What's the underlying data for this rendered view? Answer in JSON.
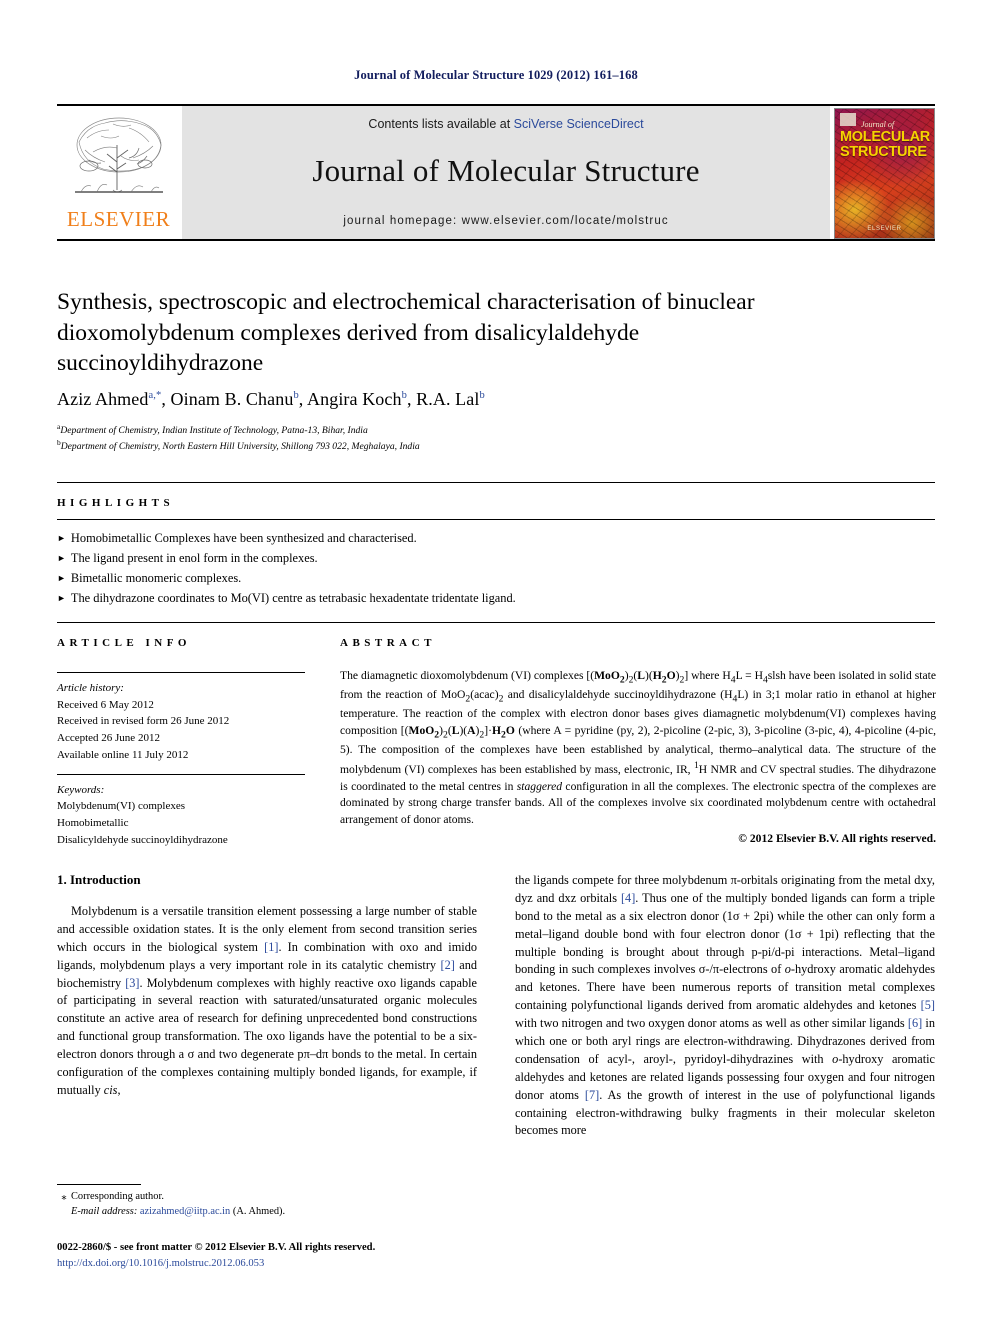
{
  "running_head": "Journal of Molecular Structure 1029 (2012) 161–168",
  "masthead": {
    "publisher_name": "ELSEVIER",
    "contents_prefix": "Contents lists available at ",
    "contents_link": "SciVerse ScienceDirect",
    "journal_title": "Journal of Molecular Structure",
    "homepage_line": "journal homepage: www.elsevier.com/locate/molstruc",
    "cover": {
      "journal_of": "Journal of",
      "title": "MOLECULAR STRUCTURE",
      "publisher": "ELSEVIER"
    }
  },
  "article": {
    "title": "Synthesis, spectroscopic and electrochemical characterisation of binuclear dioxomolybdenum complexes derived from disalicylaldehyde succinoyldihydrazone",
    "authors": [
      {
        "name": "Aziz Ahmed",
        "marks": "a,*"
      },
      {
        "name": "Oinam B. Chanu",
        "marks": "b"
      },
      {
        "name": "Angira Koch",
        "marks": "b"
      },
      {
        "name": "R.A. Lal",
        "marks": "b"
      }
    ],
    "affiliations": [
      {
        "mark": "a",
        "text": "Department of Chemistry, Indian Institute of Technology, Patna-13, Bihar, India"
      },
      {
        "mark": "b",
        "text": "Department of Chemistry, North Eastern Hill University, Shillong 793 022, Meghalaya, India"
      }
    ]
  },
  "highlights": {
    "heading": "HIGHLIGHTS",
    "items": [
      "Homobimetallic Complexes have been synthesized and characterised.",
      "The ligand present in enol form in the complexes.",
      "Bimetallic monomeric complexes.",
      "The dihydrazone coordinates to Mo(VI) centre as tetrabasic hexadentate tridentate ligand."
    ]
  },
  "article_info": {
    "heading": "ARTICLE INFO",
    "history_label": "Article history:",
    "history": [
      "Received 6 May 2012",
      "Received in revised form 26 June 2012",
      "Accepted 26 June 2012",
      "Available online 11 July 2012"
    ],
    "keywords_label": "Keywords:",
    "keywords": [
      "Molybdenum(VI) complexes",
      "Homobimetallic",
      "Disalicyldehyde succinoyldihydrazone"
    ]
  },
  "abstract": {
    "heading": "ABSTRACT",
    "copyright": "© 2012 Elsevier B.V. All rights reserved."
  },
  "introduction": {
    "heading": "1. Introduction"
  },
  "footnote": {
    "corresponding_author": "Corresponding author.",
    "email_label": "E-mail address:",
    "email": "azizahmed@iitp.ac.in",
    "email_owner": "(A. Ahmed)."
  },
  "footer": {
    "issn_line": "0022-2860/$ - see front matter © 2012 Elsevier B.V. All rights reserved.",
    "doi": "http://dx.doi.org/10.1016/j.molstruc.2012.06.053"
  }
}
